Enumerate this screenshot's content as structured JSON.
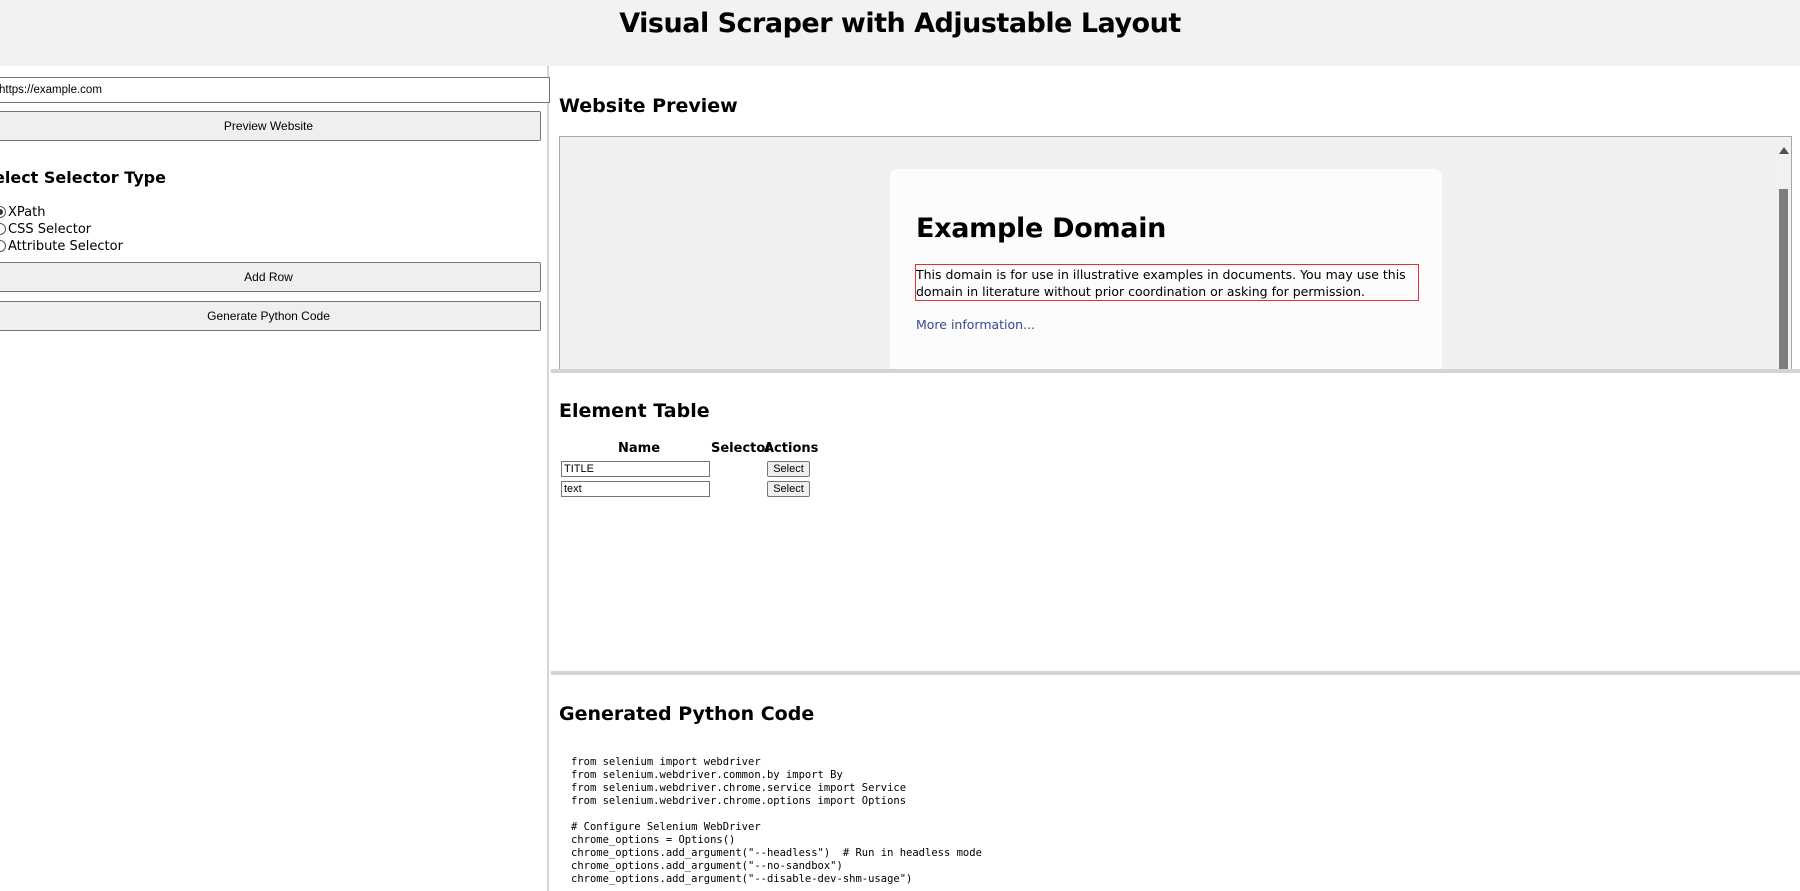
{
  "header": {
    "title": "Visual Scraper with Adjustable Layout"
  },
  "left_panel": {
    "url_input": {
      "value": "https://example.com"
    },
    "preview_button": "Preview Website",
    "selector_type_title": "elect Selector Type",
    "selector_options": [
      {
        "label": "XPath",
        "checked": true
      },
      {
        "label": "CSS Selector",
        "checked": false
      },
      {
        "label": "Attribute Selector",
        "checked": false
      }
    ],
    "add_row_button": "Add Row",
    "generate_button": "Generate Python Code"
  },
  "preview": {
    "title": "Website Preview",
    "page": {
      "heading": "Example Domain",
      "paragraph": "This domain is for use in illustrative examples in documents. You may use this domain in literature without prior coordination or asking for permission.",
      "link": "More information..."
    }
  },
  "element_table": {
    "title": "Element Table",
    "headers": [
      "Name",
      "Selector",
      "Actions"
    ],
    "rows": [
      {
        "name": "TITLE",
        "selector": "",
        "action": "Select"
      },
      {
        "name": "text",
        "selector": "",
        "action": "Select"
      }
    ]
  },
  "code_section": {
    "title": "Generated Python Code",
    "code": "from selenium import webdriver\nfrom selenium.webdriver.common.by import By\nfrom selenium.webdriver.chrome.service import Service\nfrom selenium.webdriver.chrome.options import Options\n\n# Configure Selenium WebDriver\nchrome_options = Options()\nchrome_options.add_argument(\"--headless\")  # Run in headless mode\nchrome_options.add_argument(\"--no-sandbox\")\nchrome_options.add_argument(\"--disable-dev-shm-usage\")"
  },
  "colors": {
    "header_bg": "#f2f2f2",
    "highlight_border": "#e03030",
    "link": "#38488f",
    "splitter": "#d4d4d4"
  }
}
